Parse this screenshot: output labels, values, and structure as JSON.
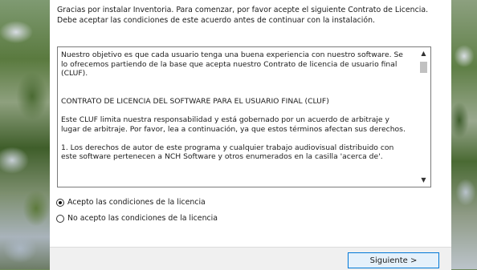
{
  "intro": "Gracias por instalar Inventoria. Para comenzar, por favor acepte el siguiente Contrato de Licencia. Debe aceptar las condiciones de este acuerdo antes de continuar con la instalación.",
  "license": {
    "paragraphs": [
      "Nuestro objetivo es que cada usuario tenga una buena experiencia con nuestro software. Se lo ofrecemos partiendo de la base que acepta nuestro Contrato de licencia de usuario final (CLUF).",
      "CONTRATO DE LICENCIA DEL SOFTWARE PARA EL USUARIO FINAL (CLUF)",
      "Este CLUF limita nuestra responsabilidad y está gobernado por un acuerdo de arbitraje y lugar de arbitraje. Por favor, lea a continuación, ya que estos términos afectan sus derechos.",
      "1. Los derechos de autor de este programa y cualquier trabajo audiovisual distribuido con este software pertenecen a NCH Software y otros enumerados en la casilla 'acerca de'."
    ],
    "scroll_up_icon": "chevron-up-icon",
    "scroll_down_icon": "chevron-down-icon"
  },
  "options": {
    "accept": "Acepto las condiciones de la licencia",
    "decline": "No acepto las condiciones de la licencia",
    "selected": "accept"
  },
  "footer": {
    "next_label": "Siguiente >"
  }
}
